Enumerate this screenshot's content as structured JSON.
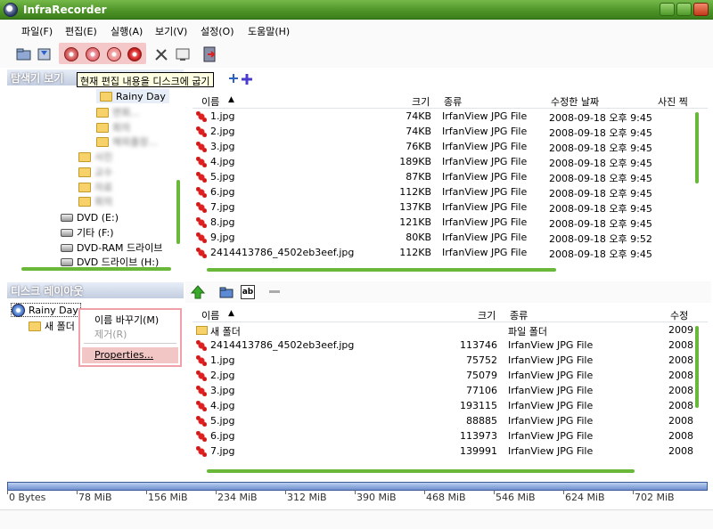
{
  "window": {
    "title": "InfraRecorder"
  },
  "menu": [
    "파일(F)",
    "편집(E)",
    "실행(A)",
    "보기(V)",
    "설정(O)",
    "도움말(H)"
  ],
  "tooltip": "현재 편집 내용을 디스크에 굽기",
  "explorer": {
    "header": "탐색기 보기",
    "tree": {
      "selected_folder": "Rainy Day",
      "blurred_items": [
        "면회...",
        "회의",
        "해외출장...",
        "사진",
        "교수",
        "자료",
        "회의"
      ],
      "drives": [
        "DVD (E:)",
        "기타 (F:)",
        "DVD-RAM 드라이브",
        "DVD 드라이브 (H:)"
      ]
    },
    "columns": {
      "name": "이름",
      "size": "크기",
      "type": "종류",
      "modified": "수정한 날짜",
      "photo": "사진 찍"
    },
    "files": [
      {
        "name": "1.jpg",
        "size": "74KB",
        "type": "IrfanView JPG File",
        "modified": "2008-09-18 오후 9:45"
      },
      {
        "name": "2.jpg",
        "size": "74KB",
        "type": "IrfanView JPG File",
        "modified": "2008-09-18 오후 9:45"
      },
      {
        "name": "3.jpg",
        "size": "76KB",
        "type": "IrfanView JPG File",
        "modified": "2008-09-18 오후 9:45"
      },
      {
        "name": "4.jpg",
        "size": "189KB",
        "type": "IrfanView JPG File",
        "modified": "2008-09-18 오후 9:45"
      },
      {
        "name": "5.jpg",
        "size": "87KB",
        "type": "IrfanView JPG File",
        "modified": "2008-09-18 오후 9:45"
      },
      {
        "name": "6.jpg",
        "size": "112KB",
        "type": "IrfanView JPG File",
        "modified": "2008-09-18 오후 9:45"
      },
      {
        "name": "7.jpg",
        "size": "137KB",
        "type": "IrfanView JPG File",
        "modified": "2008-09-18 오후 9:45"
      },
      {
        "name": "8.jpg",
        "size": "121KB",
        "type": "IrfanView JPG File",
        "modified": "2008-09-18 오후 9:45"
      },
      {
        "name": "9.jpg",
        "size": "80KB",
        "type": "IrfanView JPG File",
        "modified": "2008-09-18 오후 9:52"
      },
      {
        "name": "2414413786_4502eb3eef.jpg",
        "size": "112KB",
        "type": "IrfanView JPG File",
        "modified": "2008-09-18 오후 9:45"
      }
    ]
  },
  "layout": {
    "header": "디스크 레이아웃",
    "tree": {
      "root": "Rainy Day",
      "child": "새 폴더"
    },
    "context_menu": {
      "rename": "이름 바꾸기(M)",
      "remove": "제거(R)",
      "properties": "Properties..."
    },
    "columns": {
      "name": "이름",
      "size": "크기",
      "type": "종류",
      "modified": "수정"
    },
    "files": [
      {
        "name": "새 폴더",
        "size": "",
        "type": "파일 폴더",
        "modified": "2009",
        "folder": true
      },
      {
        "name": "2414413786_4502eb3eef.jpg",
        "size": "113746",
        "type": "IrfanView JPG File",
        "modified": "2008"
      },
      {
        "name": "1.jpg",
        "size": "75752",
        "type": "IrfanView JPG File",
        "modified": "2008"
      },
      {
        "name": "2.jpg",
        "size": "75079",
        "type": "IrfanView JPG File",
        "modified": "2008"
      },
      {
        "name": "3.jpg",
        "size": "77106",
        "type": "IrfanView JPG File",
        "modified": "2008"
      },
      {
        "name": "4.jpg",
        "size": "193115",
        "type": "IrfanView JPG File",
        "modified": "2008"
      },
      {
        "name": "5.jpg",
        "size": "88885",
        "type": "IrfanView JPG File",
        "modified": "2008"
      },
      {
        "name": "6.jpg",
        "size": "113973",
        "type": "IrfanView JPG File",
        "modified": "2008"
      },
      {
        "name": "7.jpg",
        "size": "139991",
        "type": "IrfanView JPG File",
        "modified": "2008"
      }
    ]
  },
  "capacity_scale": [
    "0 Bytes",
    "78 MiB",
    "156 MiB",
    "234 MiB",
    "312 MiB",
    "390 MiB",
    "468 MiB",
    "546 MiB",
    "624 MiB",
    "702 MiB"
  ],
  "icons": {
    "toolbar": [
      "open-project-icon",
      "save-project-icon",
      "burn-image-icon",
      "burn-compilation-icon",
      "copy-disc-icon",
      "erase-disc-icon",
      "tools-icon",
      "log-icon",
      "exit-icon"
    ]
  },
  "colors": {
    "title_green": "#4b9226",
    "accent_blue": "#6f8fcf",
    "highlight_pink": "#f3c6c6"
  }
}
